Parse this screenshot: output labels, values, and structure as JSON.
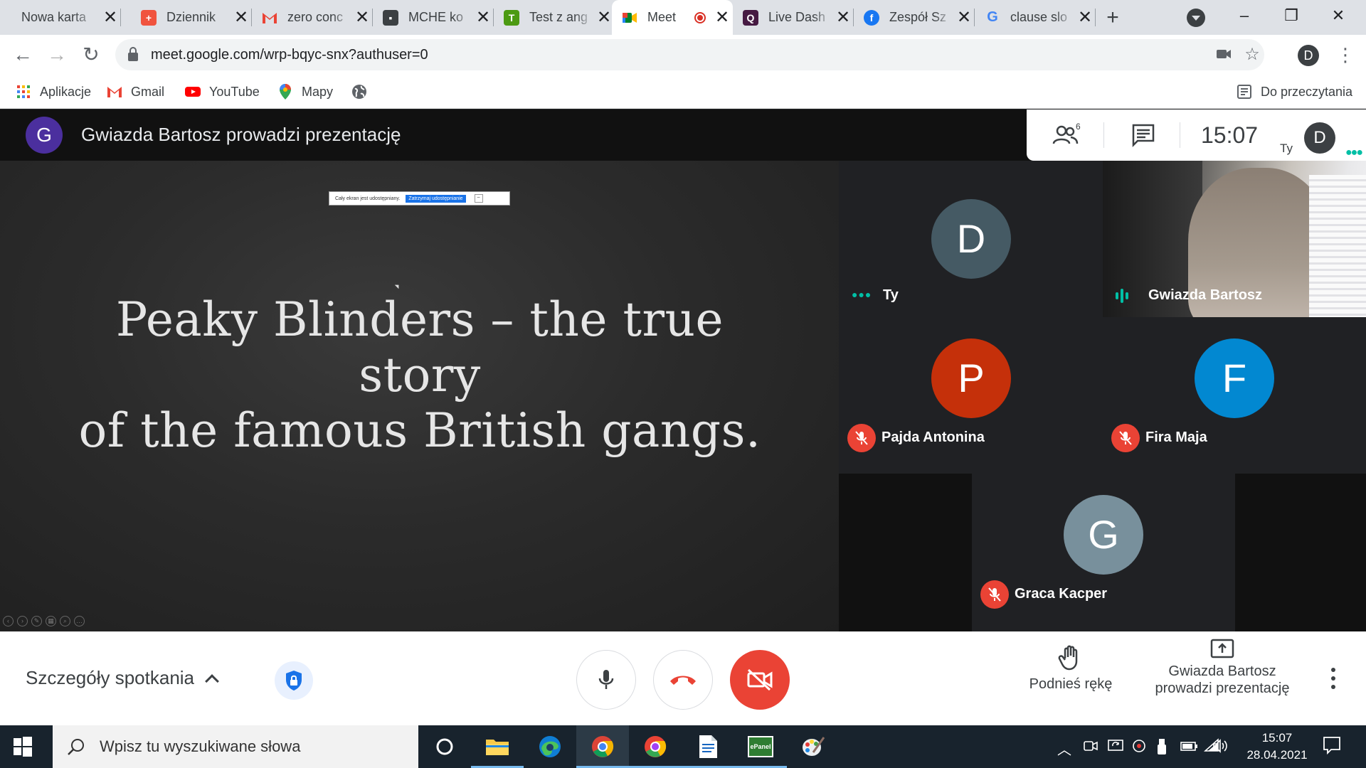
{
  "browser": {
    "tabs": [
      {
        "title": "Nowa karta",
        "icon": "none"
      },
      {
        "title": "Dziennik",
        "icon": "dziennik-icon"
      },
      {
        "title": "zero conc",
        "icon": "gmail-icon"
      },
      {
        "title": "MCHE ko",
        "icon": "classroom-icon"
      },
      {
        "title": "Test z ang",
        "icon": "testportal-icon"
      },
      {
        "title": "Meet",
        "icon": "meet-icon"
      },
      {
        "title": "Live Dash",
        "icon": "quizizz-icon"
      },
      {
        "title": "Zespół Sz",
        "icon": "facebook-icon"
      },
      {
        "title": "clause slo",
        "icon": "google-icon"
      }
    ],
    "close_glyph": "✕",
    "new_tab_glyph": "+",
    "url": "meet.google.com/wrp-bqyc-snx?authuser=0",
    "profile_initial": "D",
    "bookmarks": [
      {
        "label": "Aplikacje",
        "icon": "apps-grid-icon"
      },
      {
        "label": "Gmail",
        "icon": "gmail-icon"
      },
      {
        "label": "YouTube",
        "icon": "youtube-icon"
      },
      {
        "label": "Mapy",
        "icon": "maps-pin-icon"
      },
      {
        "label": "",
        "icon": "globe-icon"
      }
    ],
    "reading_list": "Do przeczytania"
  },
  "meet": {
    "presenter_initial": "G",
    "presenter_banner": "Gwiazda Bartosz prowadzi prezentację",
    "participant_count_badge": "6",
    "time": "15:07",
    "self_label": "Ty",
    "self_initial": "D",
    "share_bar": {
      "text": "Cały ekran jest udostępniany.",
      "stop_button": "Zatrzymaj udostępnianie",
      "minimize": "–"
    },
    "slide": {
      "title_line1": "Peaky Blinders – the true story",
      "title_line2": "of the famous British gangs."
    },
    "participants": [
      {
        "initial": "D",
        "name": "Ty",
        "color": "#455a64",
        "muted": false,
        "status": "more-dots"
      },
      {
        "initial": "",
        "name": "Gwiazda Bartosz",
        "color": "",
        "muted": false,
        "status": "speaking"
      },
      {
        "initial": "P",
        "name": "Pajda Antonina",
        "color": "#c5300a",
        "muted": true
      },
      {
        "initial": "F",
        "name": "Fira Maja",
        "color": "#0288d1",
        "muted": true
      },
      {
        "initial": "G",
        "name": "Graca Kacper",
        "color": "#78909c",
        "muted": true
      }
    ],
    "controls": {
      "details": "Szczegóły spotkania",
      "raise_hand": "Podnieś rękę",
      "presenting_line1": "Gwiazda Bartosz",
      "presenting_line2": "prowadzi prezentację"
    },
    "colors": {
      "hangup": "#ea4335",
      "accent": "#1a73e8",
      "speaking": "#00bfa5"
    }
  },
  "taskbar": {
    "search_placeholder": "Wpisz tu wyszukiwane słowa",
    "time": "15:07",
    "date": "28.04.2021",
    "apps": [
      "cortana-icon",
      "file-explorer-icon",
      "edge-icon",
      "chrome-icon",
      "chrome-profile-icon",
      "word-doc-icon",
      "epanel-icon",
      "paint-icon"
    ],
    "epanel_label": "ePanel"
  }
}
